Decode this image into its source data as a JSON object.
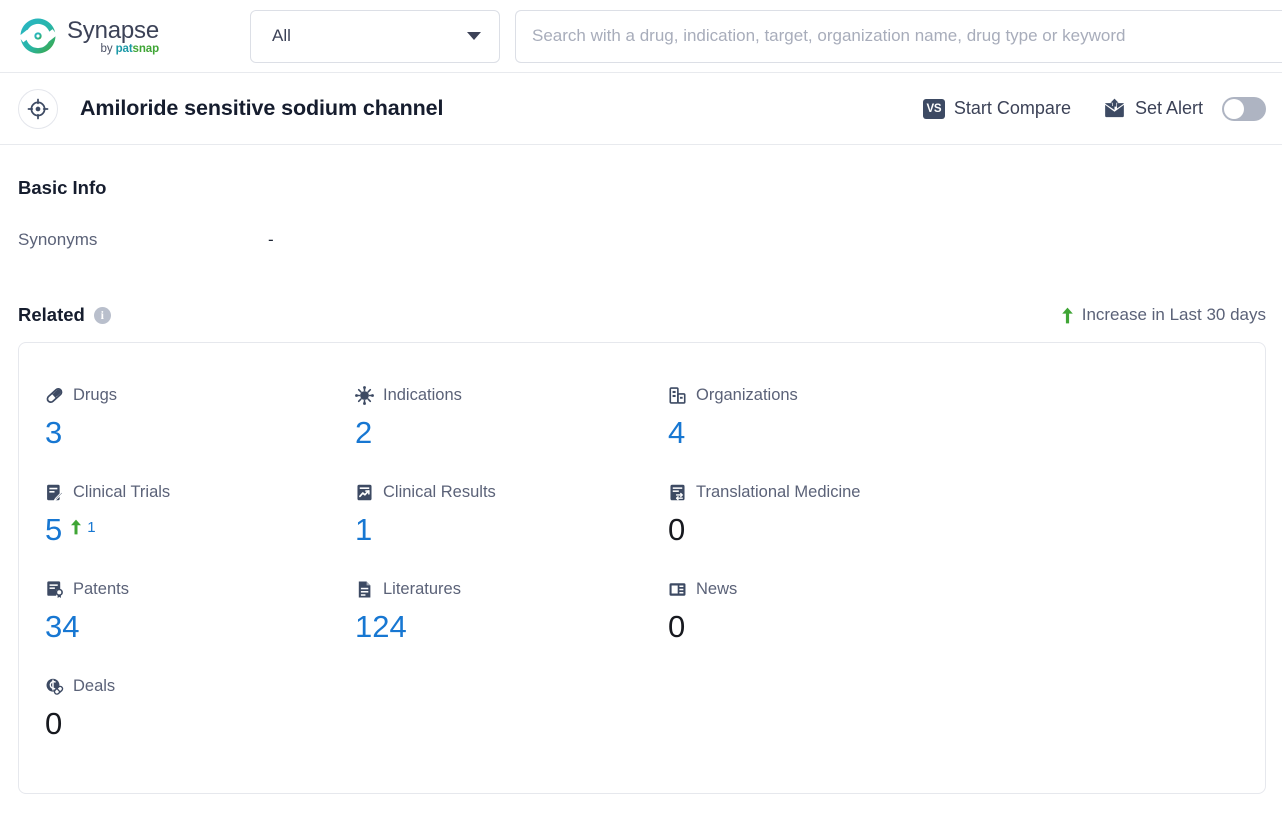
{
  "topbar": {
    "logo": {
      "title": "Synapse",
      "by": "by ",
      "pat": "pat",
      "snap": "snap",
      "icon": "synapse-logo-icon"
    },
    "category_select": {
      "value": "All",
      "caret_icon": "chevron-down-icon"
    },
    "search": {
      "value": "",
      "placeholder": "Search with a drug, indication, target, organization name, drug type or keyword",
      "icon": "search-input"
    }
  },
  "titlebar": {
    "target_icon": "target-crosshair-icon",
    "title": "Amiloride sensitive sodium channel",
    "start_compare": {
      "label": "Start Compare",
      "badge": "VS",
      "icon": "vs-badge-icon"
    },
    "set_alert": {
      "label": "Set Alert",
      "icon": "alert-envelope-icon",
      "toggle_state": "off"
    }
  },
  "basic_info": {
    "heading": "Basic Info",
    "rows": [
      {
        "label": "Synonyms",
        "value": "-"
      }
    ]
  },
  "related": {
    "heading": "Related",
    "info_icon": "info-icon",
    "info_glyph": "i",
    "legend": {
      "arrow_icon": "arrow-up-icon",
      "text": "Increase in Last 30 days"
    },
    "stats": [
      {
        "label": "Drugs",
        "icon": "pill-icon",
        "value": "3",
        "is_zero": false,
        "delta": null
      },
      {
        "label": "Indications",
        "icon": "virus-icon",
        "value": "2",
        "is_zero": false,
        "delta": null
      },
      {
        "label": "Organizations",
        "icon": "building-icon",
        "value": "4",
        "is_zero": false,
        "delta": null
      },
      {
        "label": "Clinical Trials",
        "icon": "clinical-trial-icon",
        "value": "5",
        "is_zero": false,
        "delta": "1"
      },
      {
        "label": "Clinical Results",
        "icon": "clinical-result-icon",
        "value": "1",
        "is_zero": false,
        "delta": null
      },
      {
        "label": "Translational Medicine",
        "icon": "translational-med-icon",
        "value": "0",
        "is_zero": true,
        "delta": null
      },
      {
        "label": "Patents",
        "icon": "patent-icon",
        "value": "34",
        "is_zero": false,
        "delta": null
      },
      {
        "label": "Literatures",
        "icon": "literature-icon",
        "value": "124",
        "is_zero": false,
        "delta": null
      },
      {
        "label": "News",
        "icon": "news-icon",
        "value": "0",
        "is_zero": true,
        "delta": null
      },
      {
        "label": "Deals",
        "icon": "deals-icon",
        "value": "0",
        "is_zero": true,
        "delta": null
      }
    ]
  },
  "colors": {
    "accent_blue": "#1777d2",
    "zero_black": "#17191f",
    "increase_green": "#3fa535",
    "icon_navy": "#3d4a63",
    "label_gray": "#5b6278",
    "border": "#e6e8ed"
  }
}
